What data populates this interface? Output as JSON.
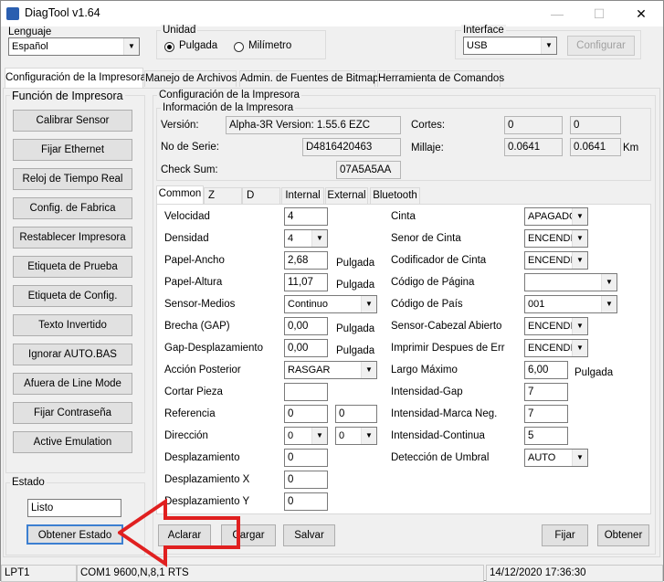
{
  "window": {
    "title": "DiagTool v1.64",
    "minimize": "—",
    "maximize": "☐",
    "close": "✕"
  },
  "lenguaje": {
    "label": "Lenguaje",
    "value": "Español"
  },
  "unidad": {
    "label": "Unidad",
    "pulgada": "Pulgada",
    "milimetro": "Milímetro",
    "selected": "Pulgada"
  },
  "interface": {
    "label": "Interface",
    "value": "USB",
    "configurar": "Configurar"
  },
  "main_tabs": [
    "Configuración de la Impresora",
    "Manejo de Archivos",
    "Admin. de Fuentes de Bitmap",
    "Herramienta de Comandos"
  ],
  "funcion": {
    "label": "Función de Impresora",
    "buttons": [
      "Calibrar Sensor",
      "Fijar Ethernet",
      "Reloj de Tiempo Real",
      "Config. de Fabrica",
      "Restablecer Impresora",
      "Etiqueta de Prueba",
      "Etiqueta de Config.",
      "Texto Invertido",
      "Ignorar AUTO.BAS",
      "Afuera de Line Mode",
      "Fijar Contraseña",
      "Active Emulation"
    ]
  },
  "estado": {
    "label": "Estado",
    "value": "Listo",
    "button": "Obtener Estado"
  },
  "config": {
    "label": "Configuración de la Impresora",
    "info_label": "Información de la Impresora",
    "version_label": "Versión:",
    "version": "Alpha-3R Version: 1.55.6 EZC",
    "serie_label": "No de Serie:",
    "serie": "D4816420463",
    "checksum_label": "Check Sum:",
    "checksum": "07A5A5AA",
    "cortes_label": "Cortes:",
    "cortes1": "0",
    "cortes2": "0",
    "millaje_label": "Millaje:",
    "millaje1": "0.0641",
    "millaje2": "0.0641",
    "millaje_unit": "Km"
  },
  "sub_tabs": [
    "Common",
    "Z",
    "D",
    "Internal",
    "External",
    "Bluetooth"
  ],
  "left_fields": [
    {
      "label": "Velocidad",
      "value": "4",
      "kind": "edit"
    },
    {
      "label": "Densidad",
      "value": "4",
      "kind": "combo"
    },
    {
      "label": "Papel-Ancho",
      "value": "2,68",
      "kind": "edit",
      "unit": "Pulgada"
    },
    {
      "label": "Papel-Altura",
      "value": "11,07",
      "kind": "edit",
      "unit": "Pulgada"
    },
    {
      "label": "Sensor-Medios",
      "value": "Continuo",
      "kind": "combo-wide"
    },
    {
      "label": "Brecha (GAP)",
      "value": "0,00",
      "kind": "edit",
      "unit": "Pulgada"
    },
    {
      "label": "Gap-Desplazamiento",
      "value": "0,00",
      "kind": "edit",
      "unit": "Pulgada"
    },
    {
      "label": "Acción Posterior",
      "value": "RASGAR",
      "kind": "combo-wide"
    },
    {
      "label": "Cortar Pieza",
      "value": "",
      "kind": "edit"
    },
    {
      "label": "Referencia",
      "value": "0",
      "value2": "0",
      "kind": "pair-edit"
    },
    {
      "label": "Dirección",
      "value": "0",
      "value2": "0",
      "kind": "pair-combo"
    },
    {
      "label": "Desplazamiento",
      "value": "0",
      "kind": "edit"
    },
    {
      "label": "Desplazamiento X",
      "value": "0",
      "kind": "edit"
    },
    {
      "label": "Desplazamiento Y",
      "value": "0",
      "kind": "edit"
    }
  ],
  "right_fields": [
    {
      "label": "Cinta",
      "value": "APAGADO",
      "kind": "combo"
    },
    {
      "label": "Senor de Cinta",
      "value": "ENCENDIDO",
      "kind": "combo"
    },
    {
      "label": "Codificador de Cinta",
      "value": "ENCENDIDO",
      "kind": "combo"
    },
    {
      "label": "Código de Página",
      "value": "",
      "kind": "combo-wide"
    },
    {
      "label": "Código de País",
      "value": "001",
      "kind": "combo-wide"
    },
    {
      "label": "Sensor-Cabezal Abierto",
      "value": "ENCENDIDO",
      "kind": "combo"
    },
    {
      "label": "Imprimir Despues de Err",
      "value": "ENCENDIDO",
      "kind": "combo"
    },
    {
      "label": "Largo Máximo",
      "value": "6,00",
      "kind": "edit",
      "unit": "Pulgada"
    },
    {
      "label": "Intensidad-Gap",
      "value": "7",
      "kind": "edit"
    },
    {
      "label": "Intensidad-Marca Neg.",
      "value": "7",
      "kind": "edit"
    },
    {
      "label": "Intensidad-Continua",
      "value": "5",
      "kind": "edit"
    },
    {
      "label": "Detección de Umbral",
      "value": "AUTO",
      "kind": "combo-mid"
    }
  ],
  "bottom_buttons": {
    "aclarar": "Aclarar",
    "cargar": "Cargar",
    "salvar": "Salvar",
    "fijar": "Fijar",
    "obtener": "Obtener"
  },
  "statusbar": {
    "port": "LPT1",
    "com": "COM1 9600,N,8,1 RTS",
    "datetime": "14/12/2020 17:36:30"
  },
  "annotation": {
    "color": "#e02020"
  }
}
